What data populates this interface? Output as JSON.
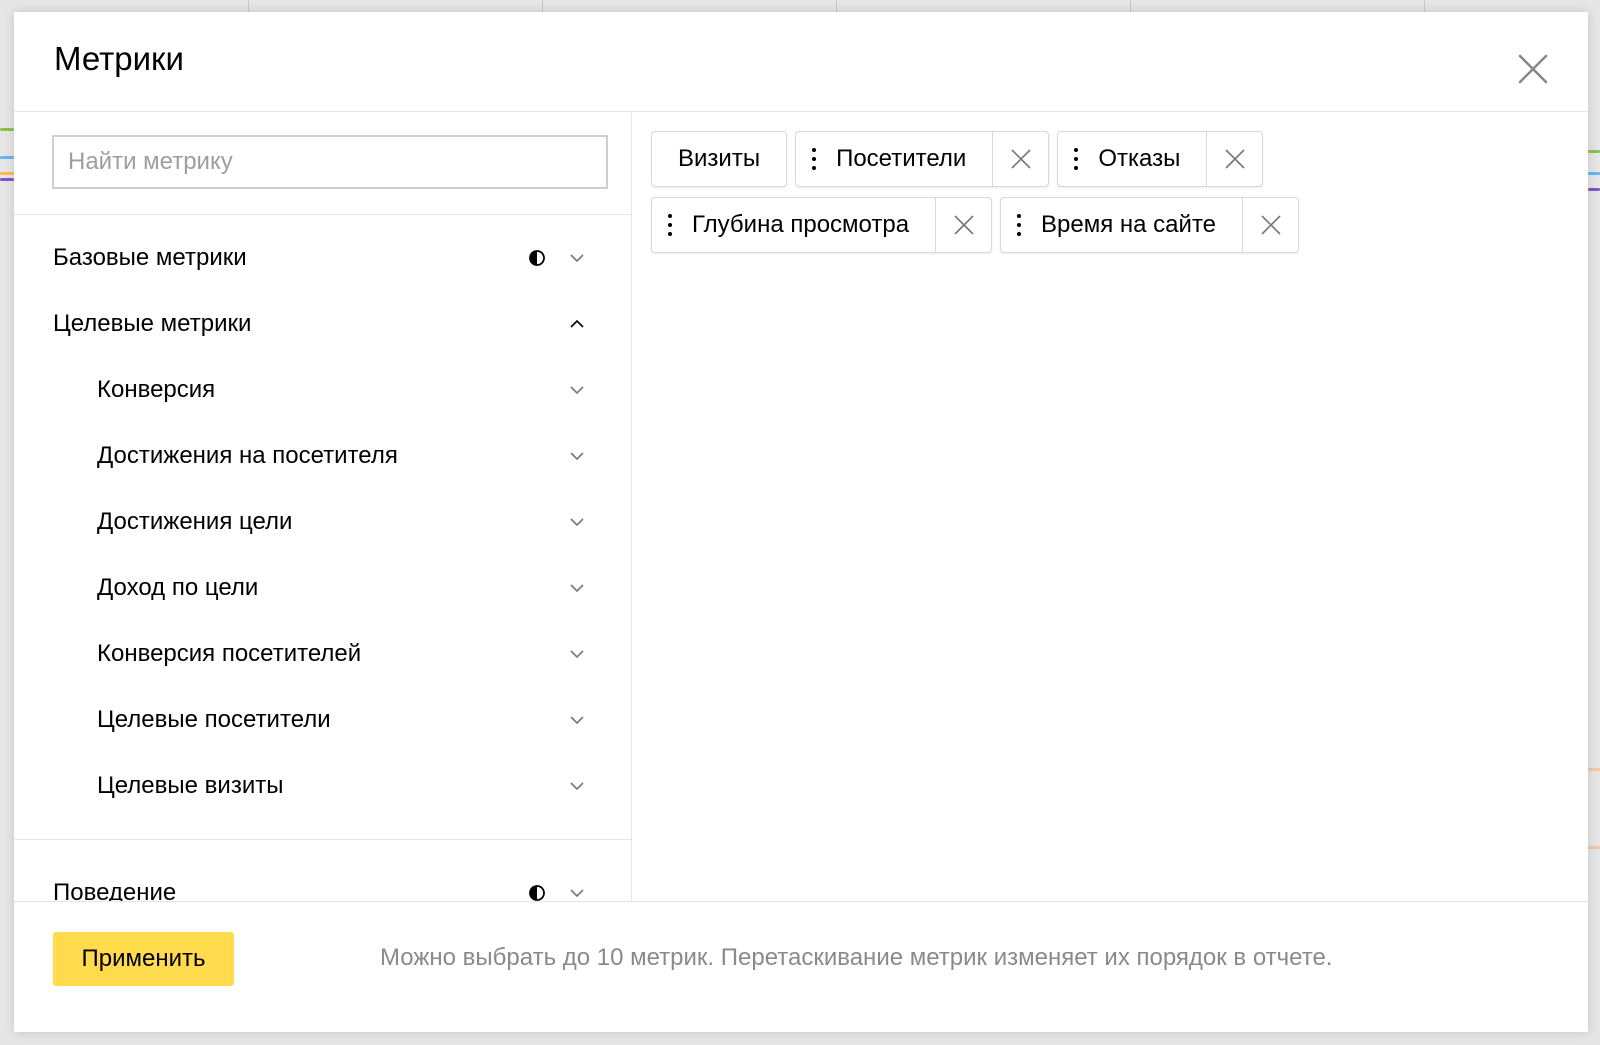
{
  "modal": {
    "title": "Метрики"
  },
  "search": {
    "placeholder": "Найти метрику",
    "value": ""
  },
  "tree": {
    "basic": {
      "label": "Базовые метрики",
      "expanded": false,
      "partial_selected": true
    },
    "goal": {
      "label": "Целевые метрики",
      "expanded": true,
      "children": [
        {
          "label": "Конверсия"
        },
        {
          "label": "Достижения на посетителя"
        },
        {
          "label": "Достижения цели"
        },
        {
          "label": "Доход по цели"
        },
        {
          "label": "Конверсия посетителей"
        },
        {
          "label": "Целевые посетители"
        },
        {
          "label": "Целевые визиты"
        }
      ]
    },
    "behavior": {
      "label": "Поведение",
      "expanded": false,
      "partial_selected": true
    }
  },
  "selected_metrics": [
    {
      "label": "Визиты",
      "removable": false,
      "draggable": false
    },
    {
      "label": "Посетители",
      "removable": true,
      "draggable": true
    },
    {
      "label": "Отказы",
      "removable": true,
      "draggable": true
    },
    {
      "label": "Глубина просмотра",
      "removable": true,
      "draggable": true
    },
    {
      "label": "Время на сайте",
      "removable": true,
      "draggable": true
    }
  ],
  "footer": {
    "apply_label": "Применить",
    "hint": "Можно выбрать до 10 метрик. Перетаскивание метрик изменяет их порядок в отчете."
  },
  "colors": {
    "accent": "#ffdb4d",
    "border": "#e5e5e5",
    "hint_text": "#8a8a8a",
    "placeholder": "#9e9e9e"
  }
}
